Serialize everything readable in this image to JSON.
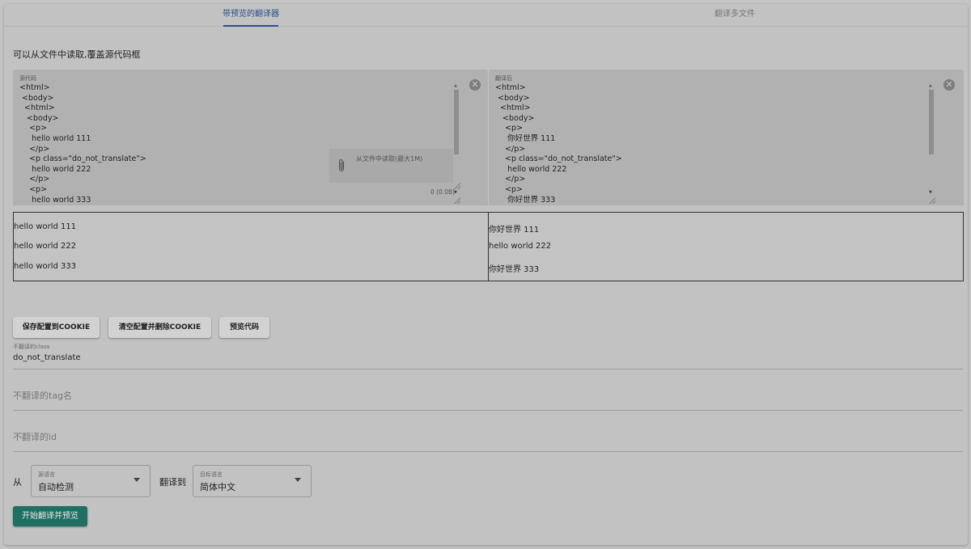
{
  "tabs": [
    {
      "label": "带预览的翻译器",
      "active": true
    },
    {
      "label": "翻译多文件",
      "active": false
    }
  ],
  "note": "可以从文件中读取,覆盖源代码框",
  "source_editor": {
    "label": "源代码",
    "code": "<html>\n <body>\n  <html>\n   <body>\n    <p>\n     hello world 111\n    </p>\n    <p class=\"do_not_translate\">\n     hello world 222\n    </p>\n    <p>\n     hello world 333",
    "file_drop_label": "从文件中读取(最大1M)",
    "file_size": "0 (0.0B)"
  },
  "translated_editor": {
    "label": "翻译后",
    "code": "<html>\n <body>\n  <html>\n   <body>\n    <p>\n     你好世界 111\n    </p>\n    <p class=\"do_not_translate\">\n     hello world 222\n    </p>\n    <p>\n     你好世界 333"
  },
  "preview_source": [
    "hello world 111",
    "hello world 222",
    "hello world 333"
  ],
  "preview_translated": [
    "你好世界 111",
    "hello world 222",
    "你好世界 333"
  ],
  "buttons": {
    "save_cookie": "保存配置到COOKIE",
    "clear_cookie": "清空配置并删除COOKIE",
    "preview_code": "预览代码"
  },
  "fields": {
    "class_label": "不翻译的class",
    "class_value": "do_not_translate",
    "tag_placeholder": "不翻译的tag名",
    "id_placeholder": "不翻译的id"
  },
  "language": {
    "from_label": "从",
    "source_select_label": "源语言",
    "source_value": "自动检测",
    "to_label": "翻译到",
    "target_select_label": "目标语言",
    "target_value": "简体中文"
  },
  "primary_button": "开始翻译并预览",
  "colors": {
    "accent": "#2a4f8a",
    "primary": "#1f6f63"
  }
}
